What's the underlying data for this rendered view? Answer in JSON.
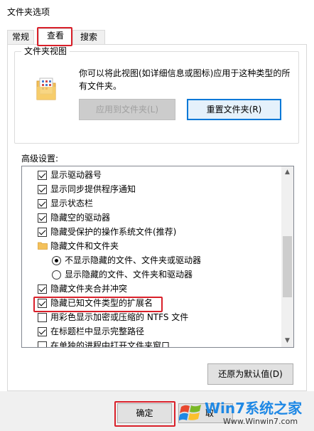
{
  "window": {
    "title": "文件夹选项"
  },
  "tabs": [
    {
      "label": "常规"
    },
    {
      "label": "查看"
    },
    {
      "label": "搜索"
    }
  ],
  "folder_views": {
    "legend": "文件夹视图",
    "description": "你可以将此视图(如详细信息或图标)应用于这种类型的所有文件夹。",
    "apply_button": "应用到文件夹(L)",
    "reset_button": "重置文件夹(R)"
  },
  "advanced": {
    "label": "高级设置:",
    "items": [
      {
        "type": "checkbox",
        "checked": true,
        "label": "显示驱动器号"
      },
      {
        "type": "checkbox",
        "checked": true,
        "label": "显示同步提供程序通知"
      },
      {
        "type": "checkbox",
        "checked": true,
        "label": "显示状态栏"
      },
      {
        "type": "checkbox",
        "checked": true,
        "label": "隐藏空的驱动器"
      },
      {
        "type": "checkbox",
        "checked": true,
        "label": "隐藏受保护的操作系统文件(推荐)"
      },
      {
        "type": "folder",
        "label": "隐藏文件和文件夹"
      },
      {
        "type": "radio",
        "checked": true,
        "label": "不显示隐藏的文件、文件夹或驱动器"
      },
      {
        "type": "radio",
        "checked": false,
        "label": "显示隐藏的文件、文件夹和驱动器"
      },
      {
        "type": "checkbox",
        "checked": true,
        "label": "隐藏文件夹合并冲突"
      },
      {
        "type": "checkbox",
        "checked": true,
        "label": "隐藏已知文件类型的扩展名"
      },
      {
        "type": "checkbox",
        "checked": false,
        "label": "用彩色显示加密或压缩的 NTFS 文件"
      },
      {
        "type": "checkbox",
        "checked": true,
        "label": "在标题栏中显示完整路径"
      },
      {
        "type": "checkbox",
        "checked": false,
        "label": "在单独的进程中打开文件夹窗口"
      }
    ],
    "restore_button": "还原为默认值(D)"
  },
  "footer": {
    "ok_button": "确定",
    "cancel_partial": "取"
  },
  "watermark": {
    "brand": "Win7系统之家",
    "url": "Www.Winwin7.com"
  },
  "colors": {
    "highlight": "#d9202a",
    "accent": "#0078d7"
  }
}
